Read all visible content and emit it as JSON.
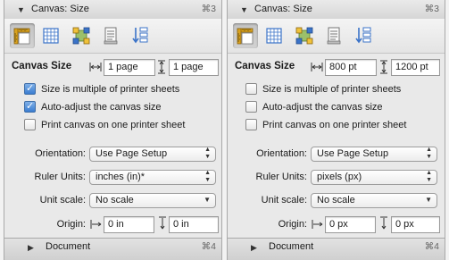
{
  "panels": [
    {
      "header": {
        "title": "Canvas: Size",
        "shortcut": "⌘3"
      },
      "toolbar": {
        "icons": [
          "ruler-icon",
          "grid-icon",
          "canvas-corners-icon",
          "document-icon",
          "layers-sort-icon"
        ],
        "active": "ruler-icon"
      },
      "canvas_size": {
        "label": "Canvas Size",
        "width": "1 page",
        "height": "1 page"
      },
      "checkboxes": [
        {
          "label": "Size is multiple of printer sheets",
          "checked": true
        },
        {
          "label": "Auto-adjust the canvas size",
          "checked": true
        },
        {
          "label": "Print canvas on one printer sheet",
          "checked": false
        }
      ],
      "orientation": {
        "label": "Orientation:",
        "value": "Use Page Setup"
      },
      "ruler_units": {
        "label": "Ruler Units:",
        "value": "inches (in)*"
      },
      "unit_scale": {
        "label": "Unit scale:",
        "value": "No scale"
      },
      "origin": {
        "label": "Origin:",
        "x": "0 in",
        "y": "0 in"
      },
      "footer": {
        "title": "Document",
        "shortcut": "⌘4"
      }
    },
    {
      "header": {
        "title": "Canvas: Size",
        "shortcut": "⌘3"
      },
      "toolbar": {
        "icons": [
          "ruler-icon",
          "grid-icon",
          "canvas-corners-icon",
          "document-icon",
          "layers-sort-icon"
        ],
        "active": "ruler-icon"
      },
      "canvas_size": {
        "label": "Canvas Size",
        "width": "800 pt",
        "height": "1200 pt"
      },
      "checkboxes": [
        {
          "label": "Size is multiple of printer sheets",
          "checked": false
        },
        {
          "label": "Auto-adjust the canvas size",
          "checked": false
        },
        {
          "label": "Print canvas on one printer sheet",
          "checked": false
        }
      ],
      "orientation": {
        "label": "Orientation:",
        "value": "Use Page Setup"
      },
      "ruler_units": {
        "label": "Ruler Units:",
        "value": "pixels (px)"
      },
      "unit_scale": {
        "label": "Unit scale:",
        "value": "No scale"
      },
      "origin": {
        "label": "Origin:",
        "x": "0 px",
        "y": "0 px"
      },
      "footer": {
        "title": "Document",
        "shortcut": "⌘4"
      }
    }
  ],
  "colors": {
    "checkbox_checked": "#3a7dd0",
    "panel_bg": "#e9e9e9",
    "icon_blue": "#3b73c8",
    "icon_gold": "#d9a21e"
  }
}
